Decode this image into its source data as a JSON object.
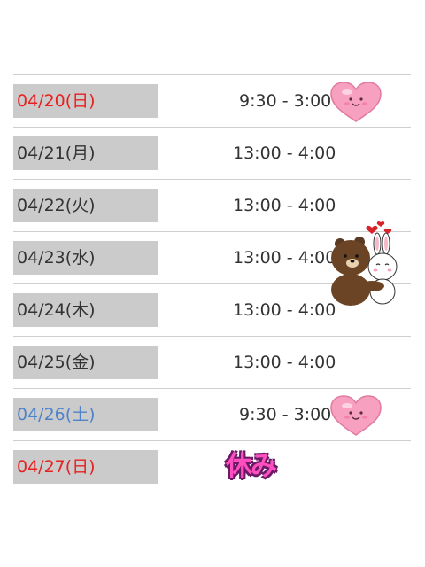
{
  "colors": {
    "sunday": "#e8201f",
    "saturday": "#4f83c9",
    "weekday": "#333333",
    "rest": "#ff4fbf"
  },
  "schedule": [
    {
      "date": "04/20(日)",
      "time": "9:30 - 3:00",
      "day_type": "sunday",
      "sticker": "heart-icon"
    },
    {
      "date": "04/21(月)",
      "time": "13:00 - 4:00",
      "day_type": "weekday"
    },
    {
      "date": "04/22(火)",
      "time": "13:00 - 4:00",
      "day_type": "weekday"
    },
    {
      "date": "04/23(水)",
      "time": "13:00 - 4:00",
      "day_type": "weekday",
      "sticker": "bear-bunny-hug-icon"
    },
    {
      "date": "04/24(木)",
      "time": "13:00 - 4:00",
      "day_type": "weekday"
    },
    {
      "date": "04/25(金)",
      "time": "13:00 - 4:00",
      "day_type": "weekday"
    },
    {
      "date": "04/26(土)",
      "time": "9:30 - 3:00",
      "day_type": "saturday",
      "sticker": "heart-icon"
    },
    {
      "date": "04/27(日)",
      "time": "休み",
      "day_type": "sunday",
      "rest": true
    }
  ]
}
